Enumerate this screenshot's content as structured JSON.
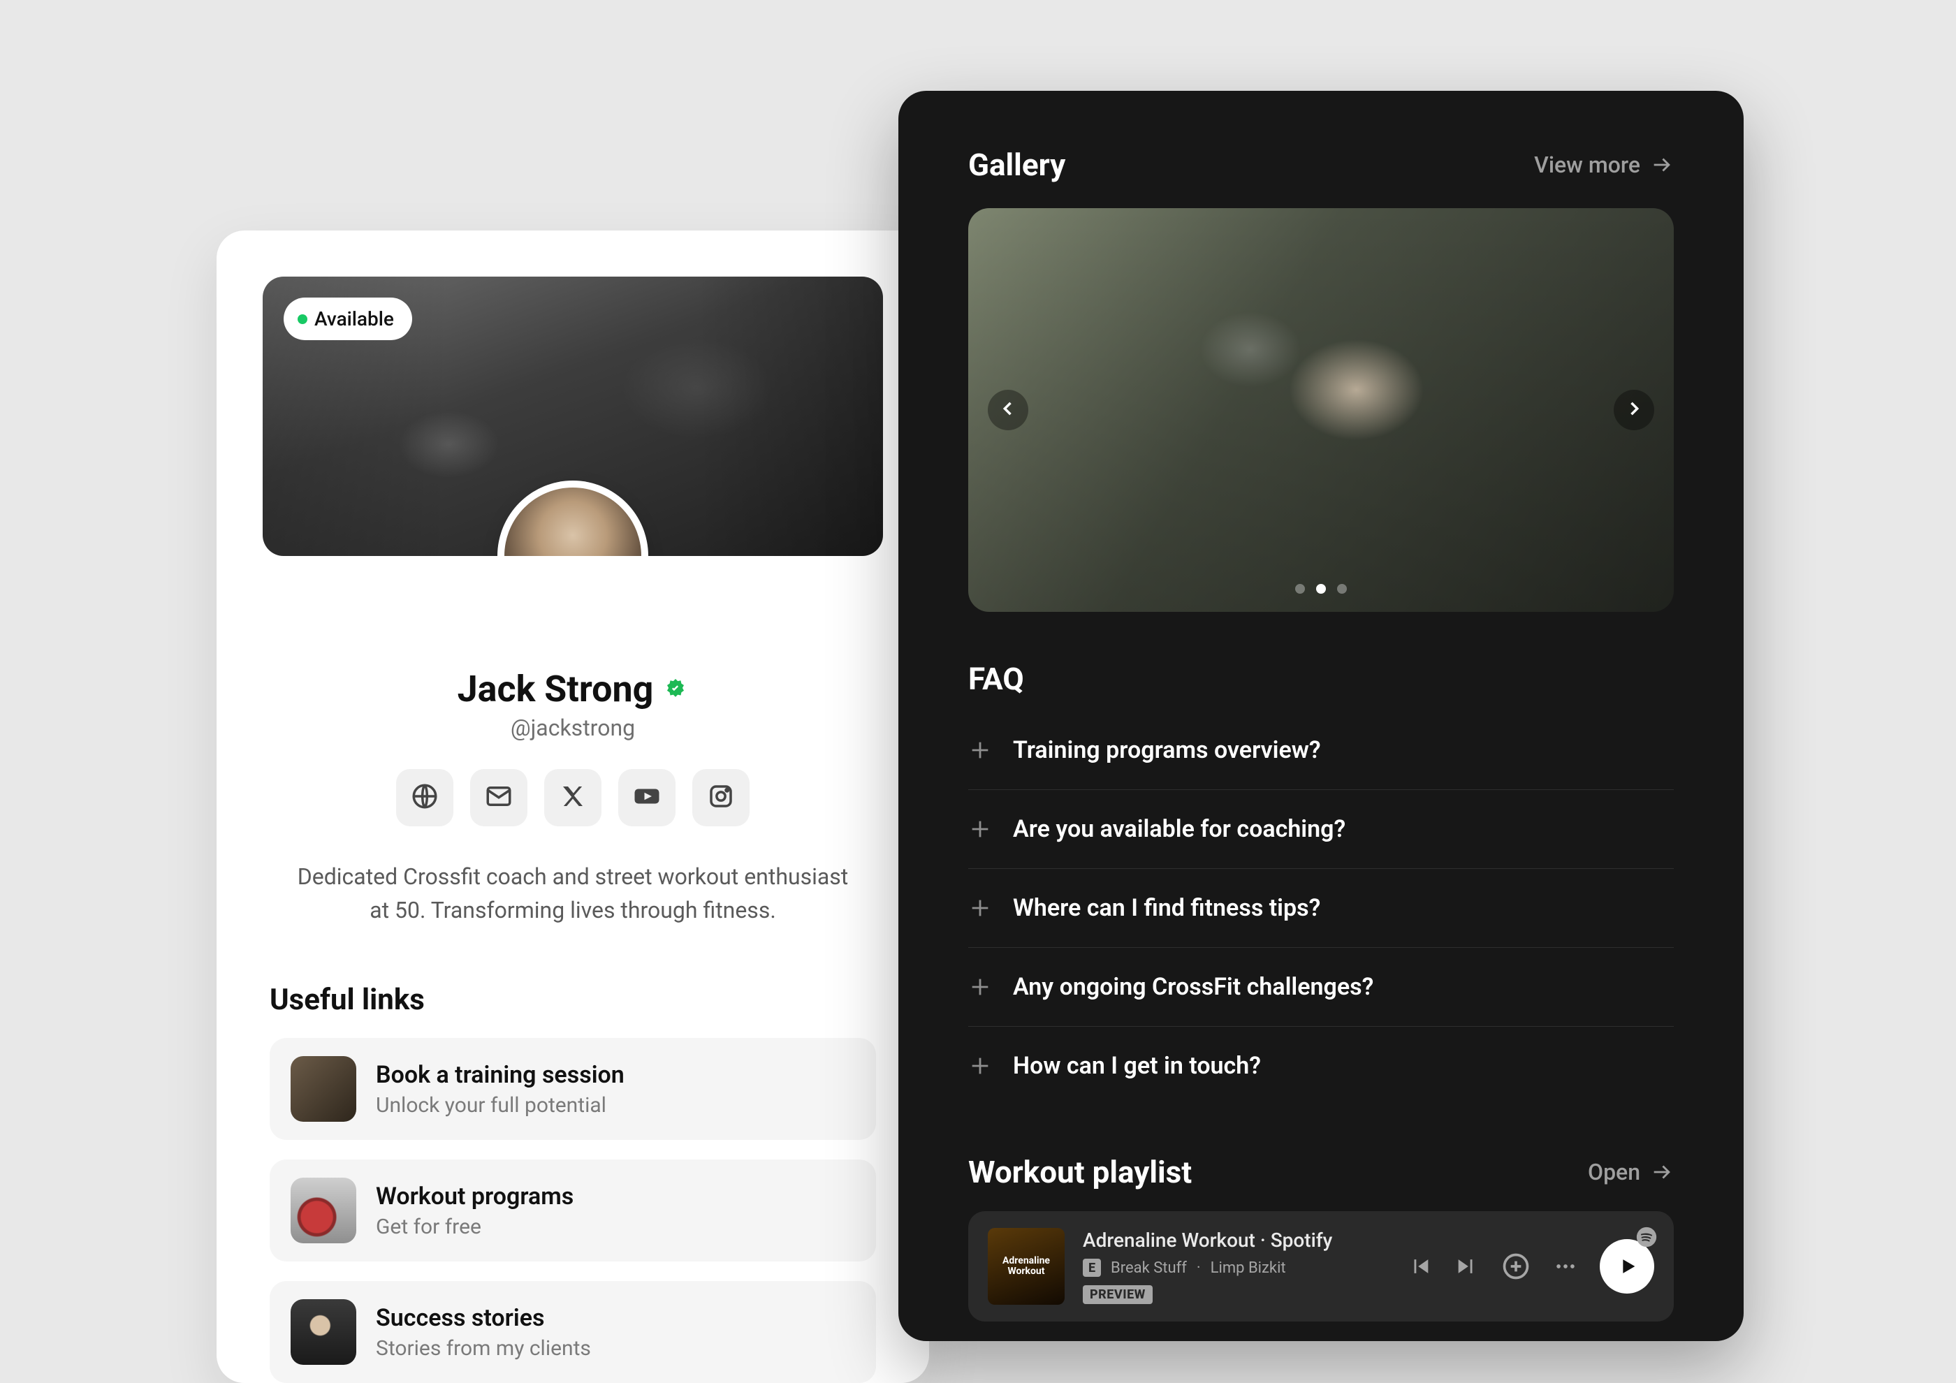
{
  "profile": {
    "status_label": "Available",
    "name": "Jack Strong",
    "handle": "@jackstrong",
    "bio": "Dedicated Crossfit coach and street workout enthusiast at 50. Transforming lives through fitness.",
    "useful_links_title": "Useful links",
    "links": [
      {
        "title": "Book a training session",
        "sub": "Unlock your full potential"
      },
      {
        "title": "Workout programs",
        "sub": "Get for free"
      },
      {
        "title": "Success stories",
        "sub": "Stories from my clients"
      }
    ],
    "socials": [
      "globe",
      "mail",
      "x",
      "youtube",
      "instagram"
    ]
  },
  "gallery": {
    "title": "Gallery",
    "view_more": "View more",
    "active_dot": 1,
    "dot_count": 3
  },
  "faq": {
    "title": "FAQ",
    "items": [
      "Training programs overview?",
      "Are you available for coaching?",
      "Where can I find fitness tips?",
      "Any ongoing CrossFit challenges?",
      "How can I get in touch?"
    ]
  },
  "playlist": {
    "title": "Workout playlist",
    "open_label": "Open",
    "album_line1": "Adrenaline",
    "album_line2": "Workout",
    "now_playing": "Adrenaline Workout · Spotify",
    "track": "Break Stuff",
    "artist": "Limp Bizkit",
    "separator": "·",
    "explicit": "E",
    "preview": "PREVIEW"
  }
}
